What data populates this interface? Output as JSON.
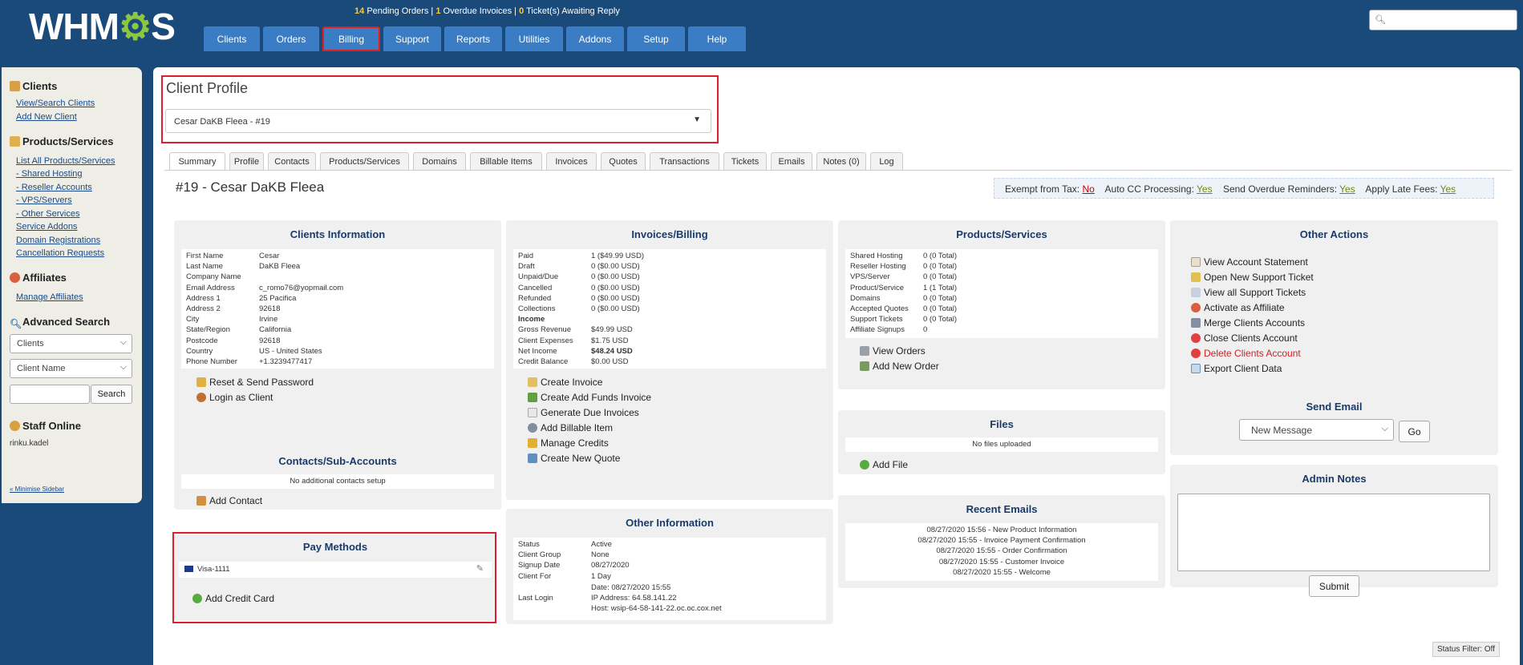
{
  "brand": {
    "logo_text_a": "WHM",
    "logo_gear": "⚙",
    "logo_text_b": "S"
  },
  "stats": {
    "pending_orders_count": "14",
    "pending_orders_label": "Pending Orders |",
    "overdue_count": "1",
    "overdue_label": "Overdue Invoices |",
    "tickets_count": "0",
    "tickets_label": "Ticket(s) Awaiting Reply"
  },
  "nav": [
    "Clients",
    "Orders",
    "Billing",
    "Support",
    "Reports",
    "Utilities",
    "Addons",
    "Setup",
    "Help"
  ],
  "sidebar": {
    "clients_title": "Clients",
    "view_search": "View/Search Clients",
    "add_new": "Add New Client",
    "products_title": "Products/Services",
    "products_links": [
      "List All Products/Services",
      "- Shared Hosting",
      "- Reseller Accounts",
      "- VPS/Servers",
      "- Other Services",
      "Service Addons",
      "Domain Registrations",
      "Cancellation Requests"
    ],
    "affiliates_title": "Affiliates",
    "manage_affiliates": "Manage Affiliates",
    "adv_title": "Advanced Search",
    "select1": "Clients",
    "select2": "Client Name",
    "search_btn": "Search",
    "staff_title": "Staff Online",
    "staff_user": "rinku.kadel",
    "minimise": "« Minimise Sidebar"
  },
  "profile": {
    "title": "Client Profile",
    "selected": "Cesar DaKB Fleea - #19"
  },
  "tabs": [
    "Summary",
    "Profile",
    "Contacts",
    "Products/Services",
    "Domains",
    "Billable Items",
    "Invoices",
    "Quotes",
    "Transactions",
    "Tickets",
    "Emails",
    "Notes (0)",
    "Log"
  ],
  "client_heading": "#19 - Cesar DaKB Fleea",
  "flags": {
    "exempt_label": "Exempt from Tax:",
    "exempt_val": "No",
    "autocc_label": "Auto CC Processing:",
    "autocc_val": "Yes",
    "overdue_label": "Send Overdue Reminders:",
    "overdue_val": "Yes",
    "late_label": "Apply Late Fees:",
    "late_val": "Yes"
  },
  "client_info": {
    "title": "Clients Information",
    "rows": [
      [
        "First Name",
        "Cesar"
      ],
      [
        "Last Name",
        "DaKB Fleea"
      ],
      [
        "Company Name",
        ""
      ],
      [
        "Email Address",
        "c_romo76@yopmail.com"
      ],
      [
        "Address 1",
        "25 Pacifica"
      ],
      [
        "Address 2",
        "92618"
      ],
      [
        "City",
        "Irvine"
      ],
      [
        "State/Region",
        "California"
      ],
      [
        "Postcode",
        "92618"
      ],
      [
        "Country",
        "US - United States"
      ],
      [
        "Phone Number",
        "+1.3239477417"
      ]
    ],
    "actions": [
      "Reset & Send Password",
      "Login as Client"
    ]
  },
  "contacts": {
    "title": "Contacts/Sub-Accounts",
    "empty": "No additional contacts setup",
    "action": "Add Contact"
  },
  "pay_methods": {
    "title": "Pay Methods",
    "card": "Visa-1111",
    "action": "Add Credit Card"
  },
  "invoices": {
    "title": "Invoices/Billing",
    "rows": [
      [
        "Paid",
        "1 ($49.99 USD)"
      ],
      [
        "Draft",
        "0 ($0.00 USD)"
      ],
      [
        "Unpaid/Due",
        "0 ($0.00 USD)"
      ],
      [
        "Cancelled",
        "0 ($0.00 USD)"
      ],
      [
        "Refunded",
        "0 ($0.00 USD)"
      ],
      [
        "Collections",
        "0 ($0.00 USD)"
      ],
      [
        "Income",
        ""
      ],
      [
        "Gross Revenue",
        "$49.99 USD"
      ],
      [
        "Client Expenses",
        "$1.75 USD"
      ],
      [
        "Net Income",
        "$48.24 USD"
      ],
      [
        "Credit Balance",
        "$0.00 USD"
      ]
    ],
    "actions": [
      "Create Invoice",
      "Create Add Funds Invoice",
      "Generate Due Invoices",
      "Add Billable Item",
      "Manage Credits",
      "Create New Quote"
    ]
  },
  "other_info": {
    "title": "Other Information",
    "rows": [
      [
        "Status",
        "Active"
      ],
      [
        "Client Group",
        "None"
      ],
      [
        "Signup Date",
        "08/27/2020"
      ],
      [
        "Client For",
        "1 Day"
      ]
    ],
    "last_login_label": "Last Login",
    "last_login_lines": [
      "Date: 08/27/2020 15:55",
      "IP Address: 64.58.141.22",
      "Host: wsip-64-58-141-22.oc.oc.cox.net"
    ]
  },
  "products": {
    "title": "Products/Services",
    "rows": [
      [
        "Shared Hosting",
        "0 (0 Total)"
      ],
      [
        "Reseller Hosting",
        "0 (0 Total)"
      ],
      [
        "VPS/Server",
        "0 (0 Total)"
      ],
      [
        "Product/Service",
        "1 (1 Total)"
      ],
      [
        "Domains",
        "0 (0 Total)"
      ],
      [
        "Accepted Quotes",
        "0 (0 Total)"
      ],
      [
        "Support Tickets",
        "0 (0 Total)"
      ],
      [
        "Affiliate Signups",
        "0"
      ]
    ],
    "actions": [
      "View Orders",
      "Add New Order"
    ]
  },
  "files": {
    "title": "Files",
    "empty": "No files uploaded",
    "action": "Add File"
  },
  "emails": {
    "title": "Recent Emails",
    "rows": [
      "08/27/2020 15:56 - New Product Information",
      "08/27/2020 15:55 - Invoice Payment Confirmation",
      "08/27/2020 15:55 - Order Confirmation",
      "08/27/2020 15:55 - Customer Invoice",
      "08/27/2020 15:55 - Welcome"
    ]
  },
  "other_actions": {
    "title": "Other Actions",
    "items": [
      "View Account Statement",
      "Open New Support Ticket",
      "View all Support Tickets",
      "Activate as Affiliate",
      "Merge Clients Accounts",
      "Close Clients Account",
      "Delete Clients Account",
      "Export Client Data"
    ]
  },
  "send_email": {
    "title": "Send Email",
    "selected": "New Message",
    "go": "Go"
  },
  "admin_notes": {
    "title": "Admin Notes",
    "submit": "Submit"
  },
  "status_filter": "Status Filter: Off",
  "colors": {
    "navy": "#1a4a7a",
    "tab_blue": "#3b7dc4",
    "highlight": "#d92030",
    "link": "#1a4a8a"
  }
}
